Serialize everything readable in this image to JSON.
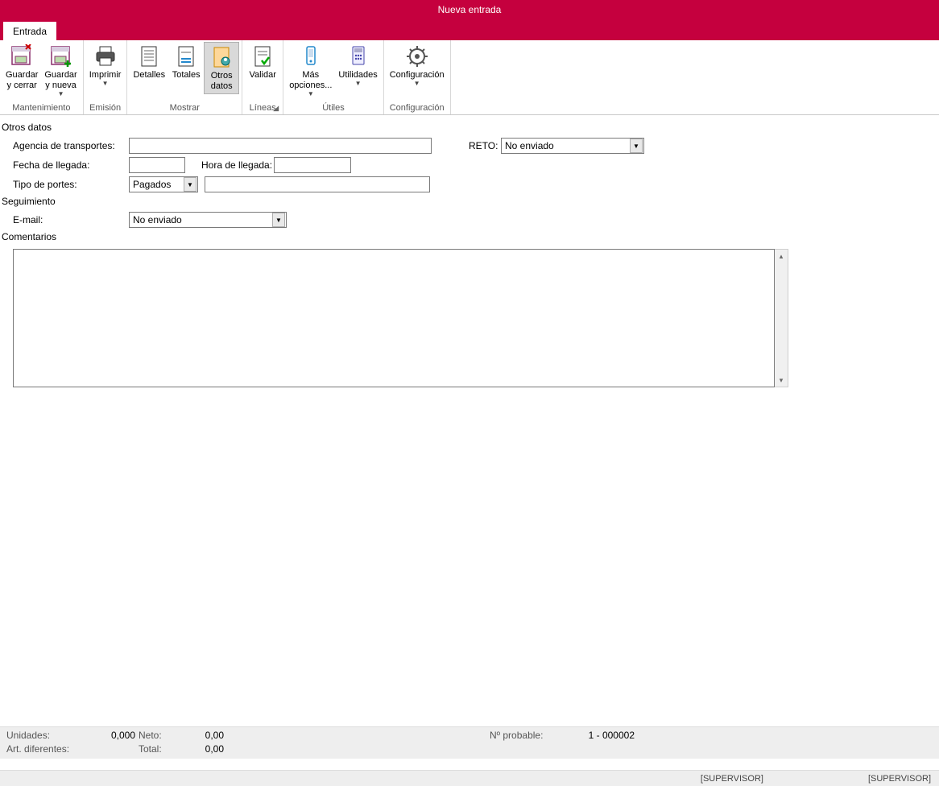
{
  "title": "Nueva entrada",
  "tab": "Entrada",
  "ribbon": {
    "groups": [
      {
        "label": "Mantenimiento",
        "buttons": [
          {
            "id": "guardar-cerrar",
            "label": "Guardar\ny cerrar",
            "icon": "save-close"
          },
          {
            "id": "guardar-nueva",
            "label": "Guardar\ny nueva",
            "icon": "save-new",
            "dropdown": true
          }
        ]
      },
      {
        "label": "Emisión",
        "buttons": [
          {
            "id": "imprimir",
            "label": "Imprimir",
            "icon": "printer",
            "dropdown": true
          }
        ]
      },
      {
        "label": "Mostrar",
        "buttons": [
          {
            "id": "detalles",
            "label": "Detalles",
            "icon": "doc-lines"
          },
          {
            "id": "totales",
            "label": "Totales",
            "icon": "doc-sum"
          },
          {
            "id": "otros-datos",
            "label": "Otros\ndatos",
            "icon": "doc-person",
            "selected": true
          }
        ]
      },
      {
        "label": "Líneas",
        "launcher": true,
        "buttons": [
          {
            "id": "validar",
            "label": "Validar",
            "icon": "doc-check"
          }
        ]
      },
      {
        "label": "Útiles",
        "buttons": [
          {
            "id": "mas-opciones",
            "label": "Más\nopciones...",
            "icon": "phone",
            "dropdown": true
          },
          {
            "id": "utilidades",
            "label": "Utilidades",
            "icon": "calc",
            "dropdown": true
          }
        ]
      },
      {
        "label": "Configuración",
        "buttons": [
          {
            "id": "configuracion",
            "label": "Configuración",
            "icon": "gear",
            "dropdown": true
          }
        ]
      }
    ]
  },
  "sections": {
    "otros": "Otros datos",
    "seguimiento": "Seguimiento",
    "comentarios": "Comentarios"
  },
  "fields": {
    "agencia_label": "Agencia de transportes:",
    "agencia_value": "",
    "reto_label": "RETO:",
    "reto_value": "No enviado",
    "fecha_label": "Fecha de llegada:",
    "fecha_value": "",
    "hora_label": "Hora de llegada:",
    "hora_value": "",
    "tipo_label": "Tipo de portes:",
    "tipo_value": "Pagados",
    "tipo_extra_value": "",
    "email_label": "E-mail:",
    "email_value": "No enviado",
    "comentarios_value": ""
  },
  "status": {
    "unidades_label": "Unidades:",
    "unidades_value": "0,000",
    "neto_label": "Neto:",
    "neto_value": "0,00",
    "art_label": "Art. diferentes:",
    "art_value": "",
    "total_label": "Total:",
    "total_value": "0,00",
    "nprob_label": "Nº probable:",
    "nprob_value": "1 - 000002",
    "user1": "[SUPERVISOR]",
    "user2": "[SUPERVISOR]"
  }
}
